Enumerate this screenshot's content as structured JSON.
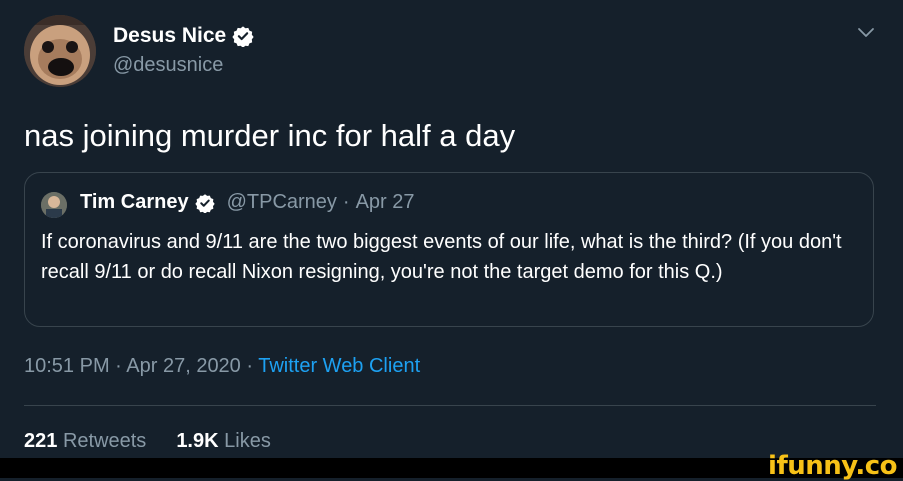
{
  "tweet": {
    "author": {
      "name": "Desus Nice",
      "handle": "@desusnice",
      "verified": true
    },
    "text": "nas joining murder inc for half a day",
    "quoted": {
      "author_name": "Tim Carney",
      "author_handle": "@TPCarney",
      "date": "Apr 27",
      "verified": true,
      "text": "If coronavirus and 9/11 are the two biggest events of our life, what is the third? (If you don't recall 9/11 or do recall Nixon resigning, you're not the target demo for this Q.)"
    },
    "timestamp": "10:51 PM · Apr 27, 2020 · ",
    "client": "Twitter Web Client",
    "stats": {
      "retweets_count": "221",
      "retweets_label": "Retweets",
      "likes_count": "1.9K",
      "likes_label": "Likes"
    }
  },
  "watermark": "ifunny.co",
  "colors": {
    "background": "#15202b",
    "secondary_text": "#8899a6",
    "link": "#1da1f2",
    "border": "#38444d",
    "watermark": "#f7c117"
  },
  "icons": [
    "verified-badge-icon",
    "chevron-down-icon"
  ]
}
